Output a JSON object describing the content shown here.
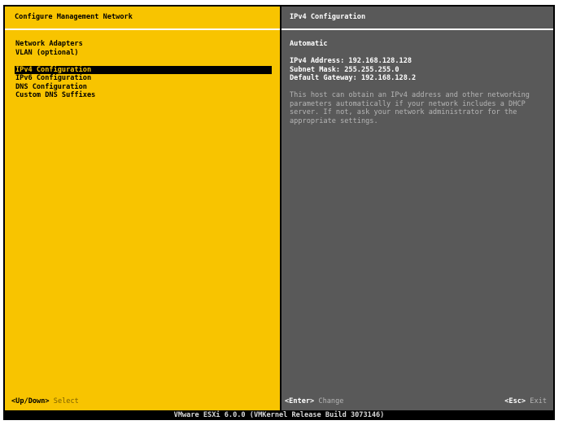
{
  "left_pane": {
    "title": "Configure Management Network",
    "menu": [
      {
        "label": "Network Adapters"
      },
      {
        "label": "VLAN (optional)"
      },
      {
        "label": "IPv4 Configuration",
        "selected": true
      },
      {
        "label": "IPv6 Configuration"
      },
      {
        "label": "DNS Configuration"
      },
      {
        "label": "Custom DNS Suffixes"
      }
    ],
    "footer": {
      "key": "<Up/Down>",
      "action": "Select"
    }
  },
  "right_pane": {
    "title": "IPv4 Configuration",
    "mode": "Automatic",
    "ipv4_address": "IPv4 Address: 192.168.128.128",
    "subnet_mask": "Subnet Mask: 255.255.255.0",
    "default_gateway": "Default Gateway: 192.168.128.2",
    "description": "This host can obtain an IPv4 address and other networking parameters automatically if your network includes a DHCP server. If not, ask your network administrator for the appropriate settings.",
    "footer_enter": {
      "key": "<Enter>",
      "action": "Change"
    },
    "footer_esc": {
      "key": "<Esc>",
      "action": "Exit"
    }
  },
  "status_bar": {
    "text": "VMware ESXi 6.0.0 (VMKernel Release Build 3073146)"
  },
  "colors": {
    "left_bg": "#f8c400",
    "right_bg": "#595959",
    "selection_bg": "#000000",
    "selection_fg": "#f8c400"
  }
}
